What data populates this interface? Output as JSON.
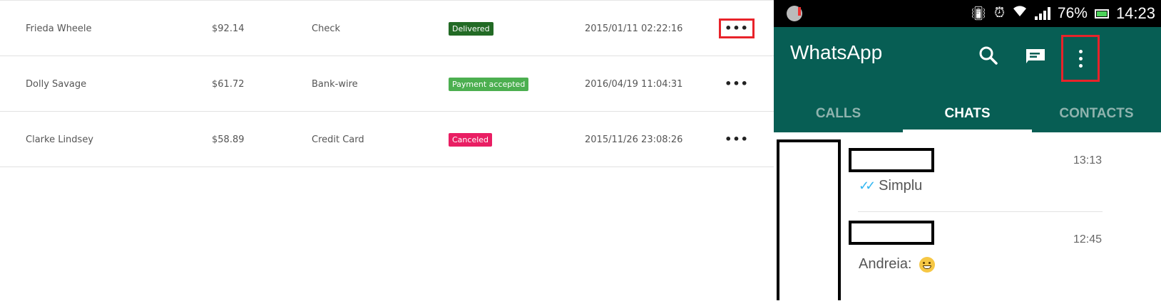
{
  "orders": [
    {
      "name": "Frieda Wheele",
      "amount": "$92.14",
      "method": "Check",
      "status": "Delivered",
      "status_color": "#226a25",
      "date": "2015/01/11 02:22:16",
      "actions": "•••"
    },
    {
      "name": "Dolly Savage",
      "amount": "$61.72",
      "method": "Bank-wire",
      "status": "Payment accepted",
      "status_color": "#4caf50",
      "date": "2016/04/19 11:04:31",
      "actions": "•••"
    },
    {
      "name": "Clarke Lindsey",
      "amount": "$58.89",
      "method": "Credit Card",
      "status": "Canceled",
      "status_color": "#e91e63",
      "date": "2015/11/26 23:08:26",
      "actions": "•••"
    }
  ],
  "phone": {
    "statusbar": {
      "battery": "76%",
      "clock": "14:23",
      "icons": [
        "notification-app-icon",
        "vibrate-icon",
        "alarm-icon",
        "wifi-icon",
        "signal-icon",
        "battery-icon"
      ]
    },
    "app_title": "WhatsApp",
    "header_color": "#075e54",
    "tabs": [
      {
        "label": "CALLS",
        "active": false
      },
      {
        "label": "CHATS",
        "active": true
      },
      {
        "label": "CONTACTS",
        "active": false
      }
    ],
    "chats": [
      {
        "time": "13:13",
        "preview": "Simplu",
        "read_ticks": true
      },
      {
        "time": "12:45",
        "preview": "Andreia:",
        "emoji": "grinning-face"
      }
    ]
  }
}
